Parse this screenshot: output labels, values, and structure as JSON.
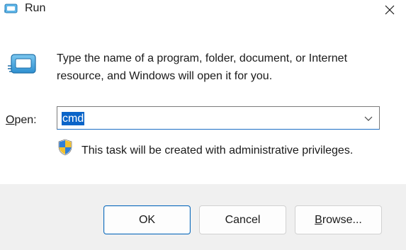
{
  "window": {
    "title": "Run"
  },
  "body": {
    "description": "Type the name of a program, folder, document, or Internet resource, and Windows will open it for you.",
    "open_label_mnemonic": "O",
    "open_label_rest": "pen:",
    "input_value": "cmd",
    "admin_note": "This task will be created with administrative privileges."
  },
  "buttons": {
    "ok_label": "OK",
    "cancel_label": "Cancel",
    "browse_mnemonic": "B",
    "browse_rest": "rowse..."
  },
  "icons": {
    "app": "run-icon",
    "close": "close-icon",
    "caret": "chevron-down-icon",
    "shield": "uac-shield-icon"
  },
  "colors": {
    "selection": "#0a64c8",
    "accent": "#0f6cbd"
  }
}
